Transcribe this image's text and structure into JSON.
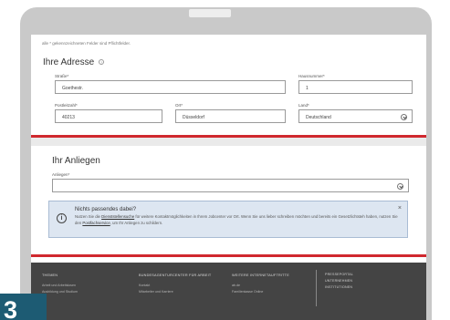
{
  "top_note": "alle * gekennzeichneten Felder sind Pflichtfelder.",
  "address": {
    "title": "Ihre Adresse",
    "info_glyph": "?",
    "fields": {
      "street": {
        "label": "Straße*",
        "value": "Goethestr."
      },
      "house_number": {
        "label": "Hausnummer*",
        "value": "1"
      },
      "postal_code": {
        "label": "Postleitzahl*",
        "value": "40213"
      },
      "city": {
        "label": "Ort*",
        "value": "Düsseldorf"
      },
      "country": {
        "label": "Land*",
        "value": "Deutschland"
      }
    }
  },
  "concern": {
    "title": "Ihr Anliegen",
    "field_label": "Anliegen*",
    "field_value": "",
    "notice": {
      "icon_glyph": "i",
      "title": "Nichts passendes dabei?",
      "text_1": "Nutzen Sie die ",
      "link_1": "Dienststellensuche",
      "text_2": " für weitere Kontaktmöglichkeiten in Ihrem Jobcenter vor Ort. Wenn Sie uns lieber schreiben möchten und bereits ein Gesetzlichtsteh haben, nutzen Sie den ",
      "link_2": "Postfachservice",
      "text_3": ", um Ihr Anliegen zu schildern.",
      "close_glyph": "×"
    }
  },
  "footer": {
    "columns": [
      {
        "heading": "THEMEN",
        "links": [
          "Arbeit und Arbeitslosen",
          "Ausbildung und Studium"
        ]
      },
      {
        "heading": "BUNDESAGENTURCENTER FÜR ARBEIT",
        "links": [
          "Kontakt",
          "Mitarbeiter und Karriere"
        ]
      },
      {
        "heading": "WEITERE INTERNETAUFTRITTE",
        "links": [
          "ab.de",
          "Familienkasse Online"
        ]
      }
    ],
    "right_links": [
      "PRESSEPORTAL",
      "UNTERNEHMEN",
      "INSTITUTIONEN"
    ]
  },
  "step_badge": "3",
  "colors": {
    "highlight_border": "#d0282e",
    "notice_bg": "#dde6f1",
    "footer_bg": "#444444",
    "badge_bg": "#1d5b73"
  }
}
